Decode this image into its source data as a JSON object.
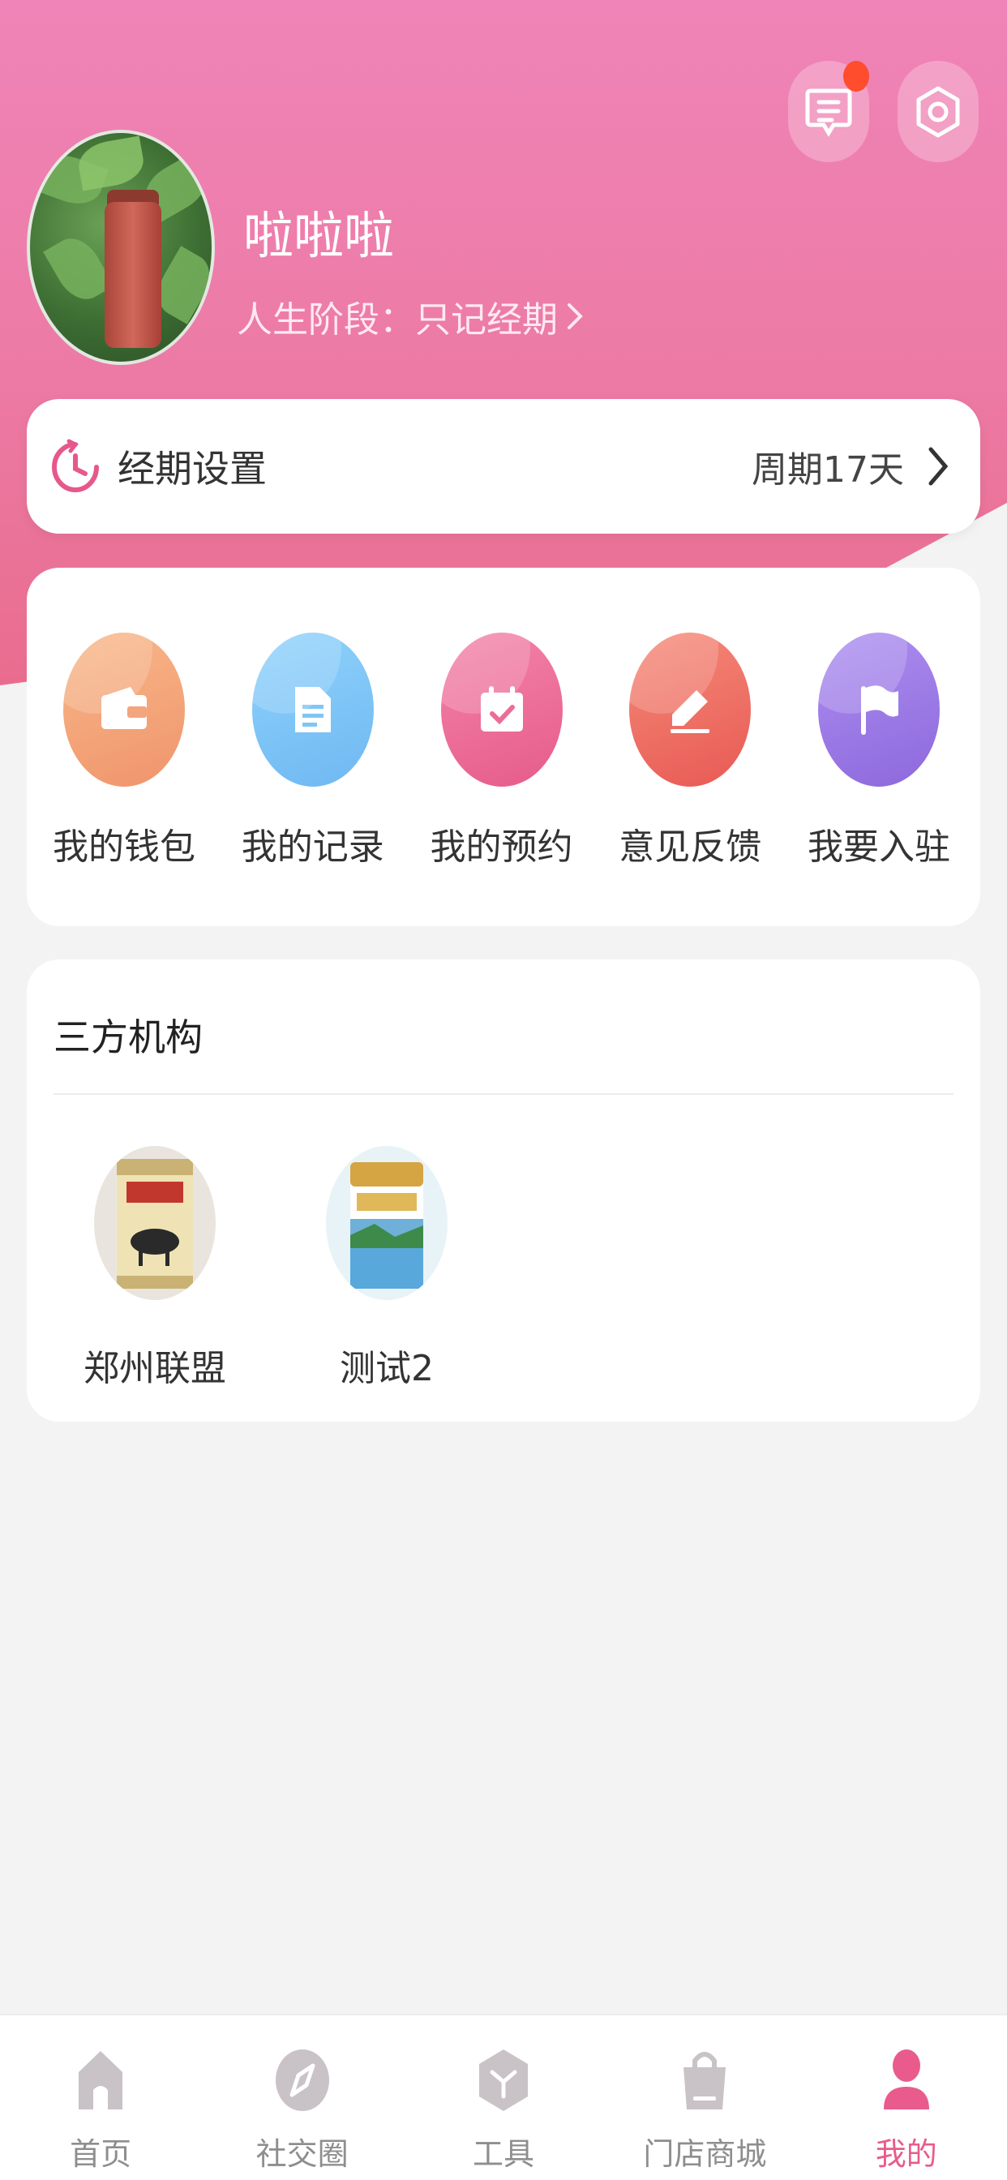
{
  "profile": {
    "name": "啦啦啦",
    "stage_label": "人生阶段：只记经期"
  },
  "period": {
    "title": "经期设置",
    "cycle": "周期17天"
  },
  "shortcuts": [
    {
      "label": "我的钱包",
      "icon": "wallet-icon",
      "color": "#f3a57d"
    },
    {
      "label": "我的记录",
      "icon": "document-icon",
      "color": "#7fc6f5"
    },
    {
      "label": "我的预约",
      "icon": "calendar-check-icon",
      "color": "#ec6d96"
    },
    {
      "label": "意见反馈",
      "icon": "pencil-icon",
      "color": "#ee6d62"
    },
    {
      "label": "我要入驻",
      "icon": "flag-icon",
      "color": "#9b7ce4"
    }
  ],
  "institutions": {
    "title": "三方机构",
    "items": [
      {
        "label": "郑州联盟"
      },
      {
        "label": "测试2"
      }
    ]
  },
  "tabbar": {
    "items": [
      {
        "label": "首页",
        "icon": "home-icon"
      },
      {
        "label": "社交圈",
        "icon": "compass-icon"
      },
      {
        "label": "工具",
        "icon": "tools-icon"
      },
      {
        "label": "门店商城",
        "icon": "shopping-bag-icon"
      },
      {
        "label": "我的",
        "icon": "user-icon"
      }
    ],
    "active_index": 4
  },
  "colors": {
    "brand_pink": "#ec7aa4",
    "active_tab": "#e95b8c",
    "notification_dot": "#ff4d2e"
  }
}
